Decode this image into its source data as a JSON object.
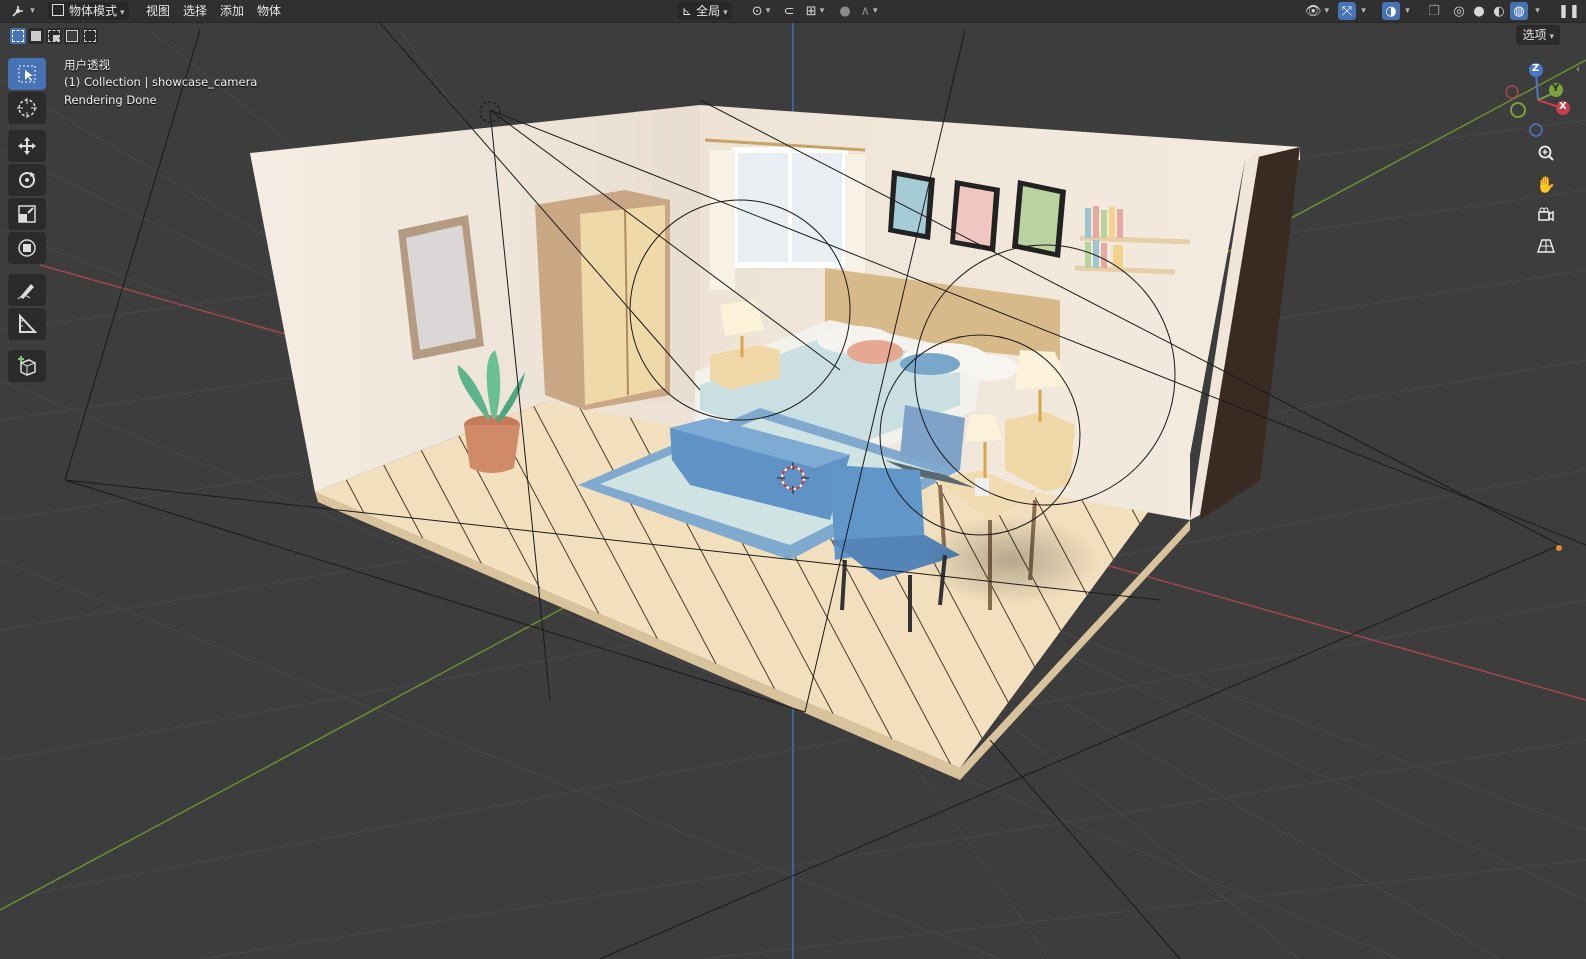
{
  "header": {
    "mode_label": "物体模式",
    "menus": [
      "视图",
      "选择",
      "添加",
      "物体"
    ],
    "transform_orientation": "全局",
    "options_label": "选项"
  },
  "overlay": {
    "view_name": "用户透视",
    "collection_info": "(1) Collection | showcase_camera",
    "status": "Rendering Done"
  },
  "gizmo": {
    "axes": [
      "X",
      "Y",
      "Z"
    ]
  },
  "colors": {
    "accent": "#4772b3",
    "viewport_bg": "#3d3d3d",
    "header_bg": "#303030",
    "axis_x": "#b34a55",
    "axis_y": "#7ba13a",
    "axis_z": "#4a78c8",
    "grid_line": "#4a4a4a"
  },
  "toolbar_tools": [
    "select-box-tool",
    "cursor-tool",
    "move-tool",
    "rotate-tool",
    "scale-tool",
    "transform-tool",
    "annotate-tool",
    "measure-tool",
    "add-cube-tool"
  ]
}
